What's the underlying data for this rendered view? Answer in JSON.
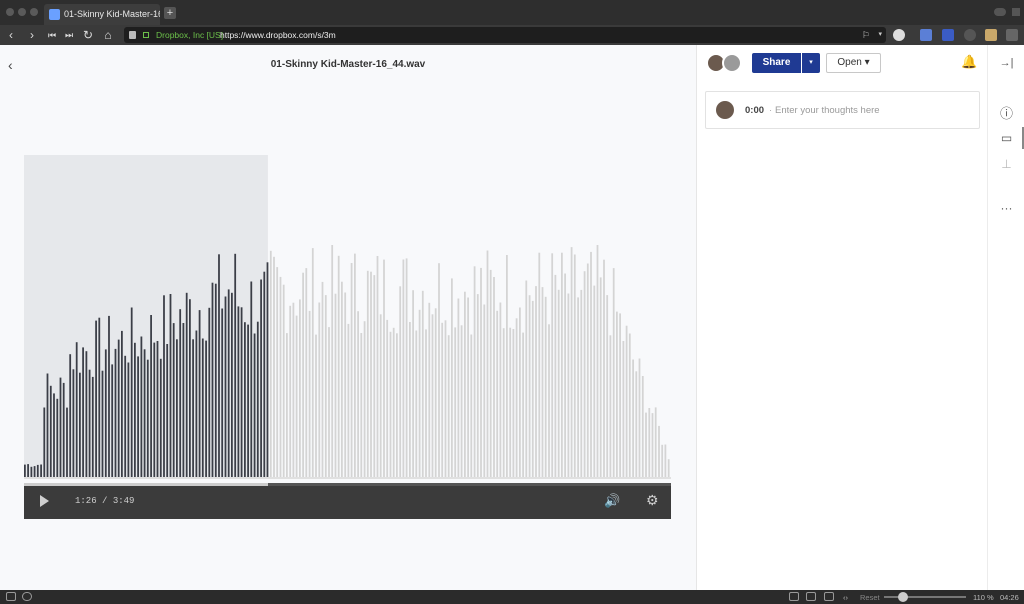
{
  "browser": {
    "tab_title": "01-Skinny Kid-Master-16_4",
    "tab_close": "‹",
    "new_tab": "+",
    "nav": {
      "back": "‹",
      "forward": "›",
      "rewind": "⏮",
      "fast_forward": "⏭",
      "reload": "↻",
      "home": "⌂"
    },
    "ev_label": "Dropbox, Inc [US]",
    "url": "https://www.dropbox.com/s/3m",
    "bookmark": "⚐",
    "dropdown": "▾"
  },
  "viewer": {
    "back": "‹",
    "filename": "01-Skinny Kid-Master-16_44.wav",
    "player": {
      "play": "",
      "current_time": "1:26",
      "separator": "/",
      "duration": "3:49",
      "progress": 0.377,
      "volume_icon": "speaker-icon",
      "settings_icon": "gear-icon"
    },
    "waveform": {
      "played_color": "#3b3e47",
      "unplayed_color": "#d4d4d4",
      "played_bg": "#e6e8eb",
      "played_fraction": 0.377
    }
  },
  "sidebar": {
    "share_label": "Share",
    "share_dropdown": "▾",
    "open_label": "Open ▾",
    "bell": "🔔",
    "comment": {
      "time": "0:00",
      "separator": "·",
      "placeholder": "Enter your thoughts here"
    }
  },
  "rail": {
    "collapse": "→|",
    "info": "ⓘ",
    "comments": "▭",
    "stamp": "⊥",
    "more": "···"
  },
  "statusbar": {
    "reset": "Reset",
    "zoom": "110 %",
    "clock": "04:26"
  },
  "colors": {
    "accent": "#1f3a93",
    "chrome": "#2e2e2e"
  }
}
